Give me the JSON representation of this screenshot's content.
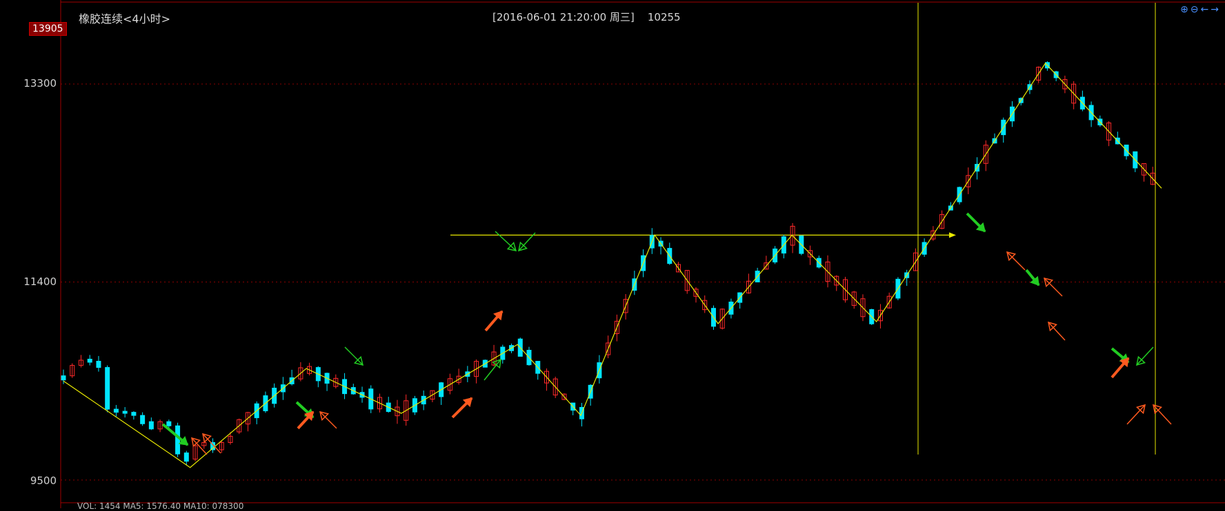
{
  "header": {
    "instrument_title": "橡胶连续<4小时>",
    "datetime_info": "[2016-06-01  21:20:00 周三]",
    "cursor_value": "10255",
    "high_marker": "13905"
  },
  "toolbar": {
    "zoom_in_icon": "⊕",
    "zoom_out_icon": "⊖",
    "scroll_left_icon": "←",
    "scroll_right_icon": "→"
  },
  "colors": {
    "up": "#ff2a2a",
    "down": "#00e5ff",
    "zigzag": "#e8e800",
    "grid": "#8b0000",
    "green_arrow": "#22cc22",
    "orange_arrow": "#ff5a1f"
  },
  "chart_data": {
    "type": "candlestick",
    "title": "橡胶连续<4小时>",
    "y_ticks": [
      9500,
      11400,
      13300
    ],
    "ylim": [
      9500,
      13905
    ],
    "grid": "dotted horizontal",
    "legend": "none",
    "zigzag_points": [
      [
        0,
        10450
      ],
      [
        12,
        9620
      ],
      [
        23,
        10570
      ],
      [
        32,
        10140
      ],
      [
        43,
        10800
      ],
      [
        49,
        10120
      ],
      [
        56,
        11850
      ],
      [
        62,
        11000
      ],
      [
        69,
        11850
      ],
      [
        77,
        11020
      ],
      [
        93,
        13500
      ],
      [
        104,
        12300
      ]
    ],
    "horizontal_level": 11850,
    "vertical_markers": [
      93,
      110
    ],
    "candles": [
      {
        "o": 10500,
        "h": 10560,
        "l": 10420,
        "c": 10460
      },
      {
        "o": 10500,
        "h": 10620,
        "l": 10480,
        "c": 10600
      },
      {
        "o": 10600,
        "h": 10700,
        "l": 10580,
        "c": 10650
      },
      {
        "o": 10660,
        "h": 10700,
        "l": 10600,
        "c": 10630
      },
      {
        "o": 10640,
        "h": 10690,
        "l": 10540,
        "c": 10580
      },
      {
        "o": 10580,
        "h": 10600,
        "l": 10150,
        "c": 10180
      },
      {
        "o": 10180,
        "h": 10220,
        "l": 10110,
        "c": 10150
      },
      {
        "o": 10160,
        "h": 10200,
        "l": 10100,
        "c": 10140
      },
      {
        "o": 10150,
        "h": 10160,
        "l": 10080,
        "c": 10120
      },
      {
        "o": 10120,
        "h": 10150,
        "l": 10020,
        "c": 10040
      },
      {
        "o": 10060,
        "h": 10100,
        "l": 9980,
        "c": 9990
      },
      {
        "o": 9990,
        "h": 10080,
        "l": 9960,
        "c": 10060
      },
      {
        "o": 10060,
        "h": 10080,
        "l": 9980,
        "c": 10020
      },
      {
        "o": 10020,
        "h": 10050,
        "l": 9720,
        "c": 9750
      },
      {
        "o": 9760,
        "h": 9780,
        "l": 9640,
        "c": 9680
      },
      {
        "o": 9700,
        "h": 9850,
        "l": 9680,
        "c": 9830
      },
      {
        "o": 9830,
        "h": 9900,
        "l": 9800,
        "c": 9860
      },
      {
        "o": 9860,
        "h": 9900,
        "l": 9760,
        "c": 9790
      },
      {
        "o": 9790,
        "h": 9880,
        "l": 9760,
        "c": 9860
      },
      {
        "o": 9860,
        "h": 9960,
        "l": 9840,
        "c": 9920
      },
      {
        "o": 9920,
        "h": 10000,
        "l": 9800,
        "c": 9830
      },
      {
        "o": 9830,
        "h": 10100,
        "l": 9820,
        "c": 10080
      },
      {
        "o": 10080,
        "h": 10300,
        "l": 10060,
        "c": 10280
      },
      {
        "o": 10280,
        "h": 10330,
        "l": 10180,
        "c": 10200
      },
      {
        "o": 10200,
        "h": 10260,
        "l": 10120,
        "c": 10150
      },
      {
        "o": 10150,
        "h": 10200,
        "l": 10100,
        "c": 10170
      },
      {
        "o": 10170,
        "h": 10210,
        "l": 10130,
        "c": 10150
      },
      {
        "o": 10150,
        "h": 10360,
        "l": 10140,
        "c": 10340
      },
      {
        "o": 10340,
        "h": 10440,
        "l": 10300,
        "c": 10420
      },
      {
        "o": 10420,
        "h": 10450,
        "l": 10280,
        "c": 10300
      },
      {
        "o": 10300,
        "h": 10320,
        "l": 10180,
        "c": 10210
      },
      {
        "o": 10210,
        "h": 10240,
        "l": 10160,
        "c": 10180
      },
      {
        "o": 10180,
        "h": 10260,
        "l": 10160,
        "c": 10230
      },
      {
        "o": 10230,
        "h": 10300,
        "l": 10200,
        "c": 10260
      },
      {
        "o": 10260,
        "h": 10380,
        "l": 10230,
        "c": 10350
      },
      {
        "o": 10350,
        "h": 10380,
        "l": 10110,
        "c": 10130
      },
      {
        "o": 10130,
        "h": 10180,
        "l": 10080,
        "c": 10150
      },
      {
        "o": 10150,
        "h": 10200,
        "l": 10100,
        "c": 10120
      },
      {
        "o": 10120,
        "h": 10180,
        "l": 10090,
        "c": 10160
      },
      {
        "o": 10160,
        "h": 10220,
        "l": 10080,
        "c": 10100
      },
      {
        "o": 10100,
        "h": 10160,
        "l": 10060,
        "c": 10140
      },
      {
        "o": 10140,
        "h": 10200,
        "l": 10120,
        "c": 10180
      },
      {
        "o": 10180,
        "h": 10300,
        "l": 10160,
        "c": 10260
      },
      {
        "o": 10260,
        "h": 10290,
        "l": 10200,
        "c": 10230
      },
      {
        "o": 10230,
        "h": 10480,
        "l": 10220,
        "c": 10470
      },
      {
        "o": 10470,
        "h": 10560,
        "l": 10440,
        "c": 10520
      },
      {
        "o": 10520,
        "h": 10560,
        "l": 10460,
        "c": 10500
      },
      {
        "o": 10500,
        "h": 10540,
        "l": 10420,
        "c": 10440
      },
      {
        "o": 10440,
        "h": 10500,
        "l": 10420,
        "c": 10470
      },
      {
        "o": 10470,
        "h": 10500,
        "l": 10430,
        "c": 10460
      },
      {
        "o": 10460,
        "h": 10500,
        "l": 10420,
        "c": 10480
      },
      {
        "o": 10480,
        "h": 10560,
        "l": 10440,
        "c": 10540
      },
      {
        "o": 10540,
        "h": 10800,
        "l": 10520,
        "c": 10720
      },
      {
        "o": 10720,
        "h": 10780,
        "l": 10580,
        "c": 10600
      },
      {
        "o": 10600,
        "h": 10660,
        "l": 10520,
        "c": 10560
      },
      {
        "o": 10560,
        "h": 10620,
        "l": 10480,
        "c": 10520
      },
      {
        "o": 10520,
        "h": 10600,
        "l": 10440,
        "c": 10560
      },
      {
        "o": 10560,
        "h": 10760,
        "l": 10540,
        "c": 10620
      },
      {
        "o": 10620,
        "h": 10640,
        "l": 10380,
        "c": 10400
      },
      {
        "o": 10400,
        "h": 10460,
        "l": 10330,
        "c": 10360
      },
      {
        "o": 10360,
        "h": 10400,
        "l": 10250,
        "c": 10280
      },
      {
        "o": 10280,
        "h": 10400,
        "l": 10240,
        "c": 10390
      },
      {
        "o": 10390,
        "h": 10420,
        "l": 10180,
        "c": 10220
      },
      {
        "o": 10220,
        "h": 10320,
        "l": 10160,
        "c": 10300
      }
    ]
  },
  "bottom_text": "VOL: 1454  MA5: 1576.40  MA10: 078300"
}
